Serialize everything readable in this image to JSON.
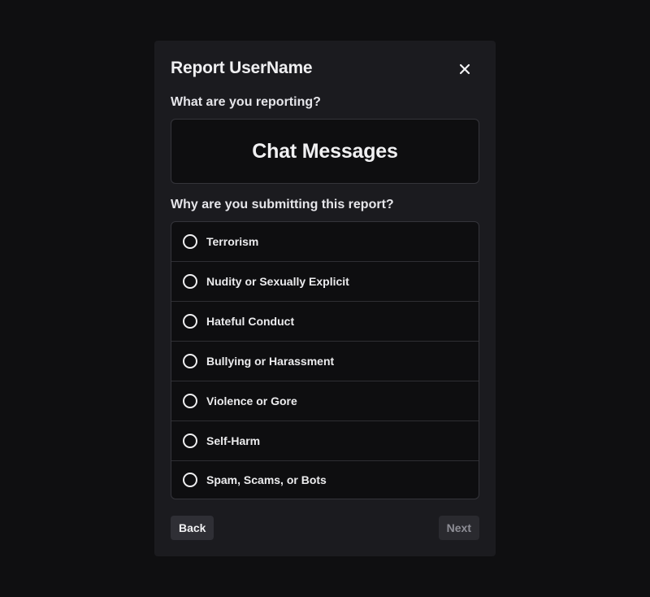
{
  "dialog": {
    "title": "Report UserName",
    "close_icon": "close-icon"
  },
  "what_section": {
    "label": "What are you reporting?",
    "selected_category": "Chat Messages"
  },
  "why_section": {
    "label": "Why are you submitting this report?",
    "options": [
      {
        "label": "Terrorism",
        "selected": false
      },
      {
        "label": "Nudity or Sexually Explicit",
        "selected": false
      },
      {
        "label": "Hateful Conduct",
        "selected": false
      },
      {
        "label": "Bullying or Harassment",
        "selected": false
      },
      {
        "label": "Violence or Gore",
        "selected": false
      },
      {
        "label": "Self-Harm",
        "selected": false
      },
      {
        "label": "Spam, Scams, or Bots",
        "selected": false
      }
    ]
  },
  "footer": {
    "back_label": "Back",
    "next_label": "Next",
    "next_disabled": true
  },
  "colors": {
    "page_background": "#0f0f11",
    "modal_background": "#1b1b1f",
    "box_background": "#0e0e10",
    "border": "#34343a",
    "text": "#ececee",
    "disabled_text": "#8e8e96"
  }
}
